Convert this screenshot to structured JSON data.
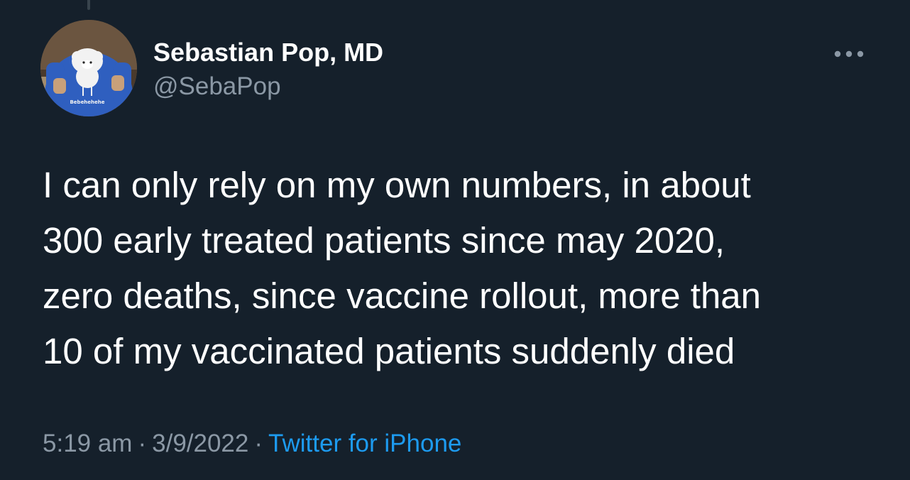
{
  "author": {
    "display_name": "Sebastian Pop, MD",
    "handle": "@SebaPop",
    "avatar_shirt_text": "Bebehehehe"
  },
  "tweet": {
    "text": "I can only rely on my own numbers, in about\n300 early treated patients since may 2020,\nzero deaths, since vaccine rollout, more than\n10 of my vaccinated patients suddenly died"
  },
  "meta": {
    "time": "5:19 am",
    "separator": "·",
    "date": "3/9/2022",
    "source": "Twitter for iPhone"
  },
  "icons": {
    "more": "more-horizontal-icon"
  },
  "colors": {
    "background": "#15202b",
    "text_primary": "#ffffff",
    "text_secondary": "#8b98a5",
    "link": "#1d9bf0"
  }
}
